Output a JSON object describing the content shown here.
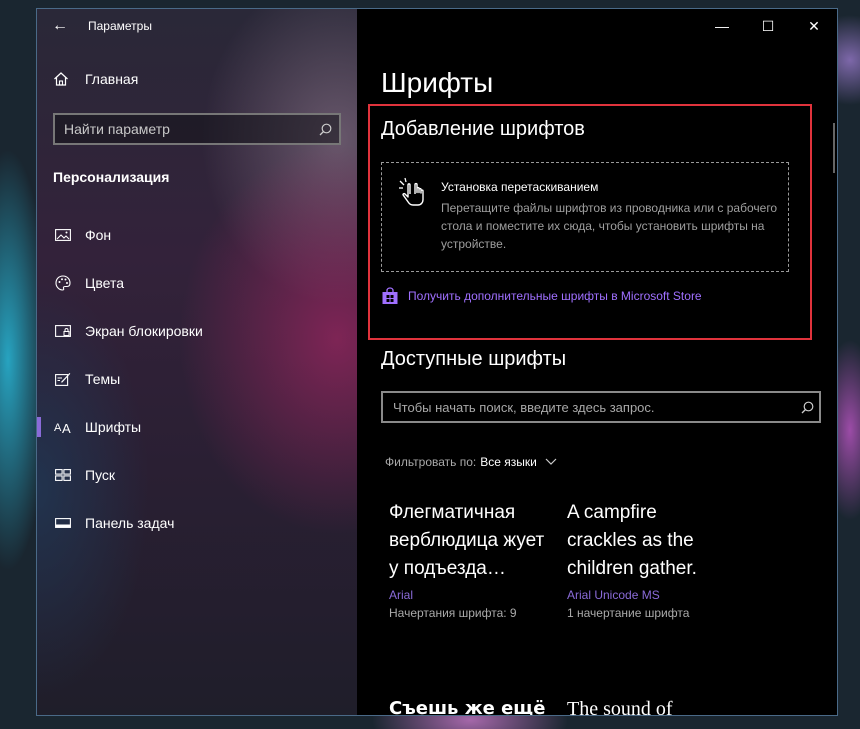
{
  "window": {
    "title": "Параметры",
    "back_glyph": "←",
    "controls": {
      "minimize": "—",
      "maximize": "☐",
      "close": "✕"
    }
  },
  "sidebar": {
    "home_label": "Главная",
    "search_placeholder": "Найти параметр",
    "section_title": "Персонализация",
    "items": [
      {
        "label": "Фон",
        "icon": "picture-icon",
        "active": false
      },
      {
        "label": "Цвета",
        "icon": "palette-icon",
        "active": false
      },
      {
        "label": "Экран блокировки",
        "icon": "lock-screen-icon",
        "active": false
      },
      {
        "label": "Темы",
        "icon": "themes-icon",
        "active": false
      },
      {
        "label": "Шрифты",
        "icon": "font-icon",
        "active": true
      },
      {
        "label": "Пуск",
        "icon": "start-icon",
        "active": false
      },
      {
        "label": "Панель задач",
        "icon": "taskbar-icon",
        "active": false
      }
    ]
  },
  "main": {
    "page_title": "Шрифты",
    "add_fonts": {
      "heading": "Добавление шрифтов",
      "dropzone_title": "Установка перетаскиванием",
      "dropzone_description": "Перетащите файлы шрифтов из проводника или с рабочего стола и поместите их сюда, чтобы установить шрифты на устройстве.",
      "store_link": "Получить дополнительные шрифты в Microsoft Store"
    },
    "available_fonts": {
      "heading": "Доступные шрифты",
      "search_placeholder": "Чтобы начать поиск, введите здесь запрос.",
      "filter_label": "Фильтровать по:",
      "filter_value": "Все языки",
      "cards": [
        {
          "sample": "Флегматичная верблюдица жует у подъезда…",
          "name": "Arial",
          "styles": "Начертания шрифта: 9"
        },
        {
          "sample": "A campfire crackles as the children gather.",
          "name": "Arial Unicode MS",
          "styles": "1 начертание шрифта"
        },
        {
          "sample": "Съешь же ещё",
          "name": "",
          "styles": ""
        },
        {
          "sample": "The sound of",
          "name": "",
          "styles": ""
        }
      ]
    }
  },
  "colors": {
    "accent": "#8a6bd8",
    "link": "#a070ff",
    "highlight_border": "#e0333c"
  }
}
